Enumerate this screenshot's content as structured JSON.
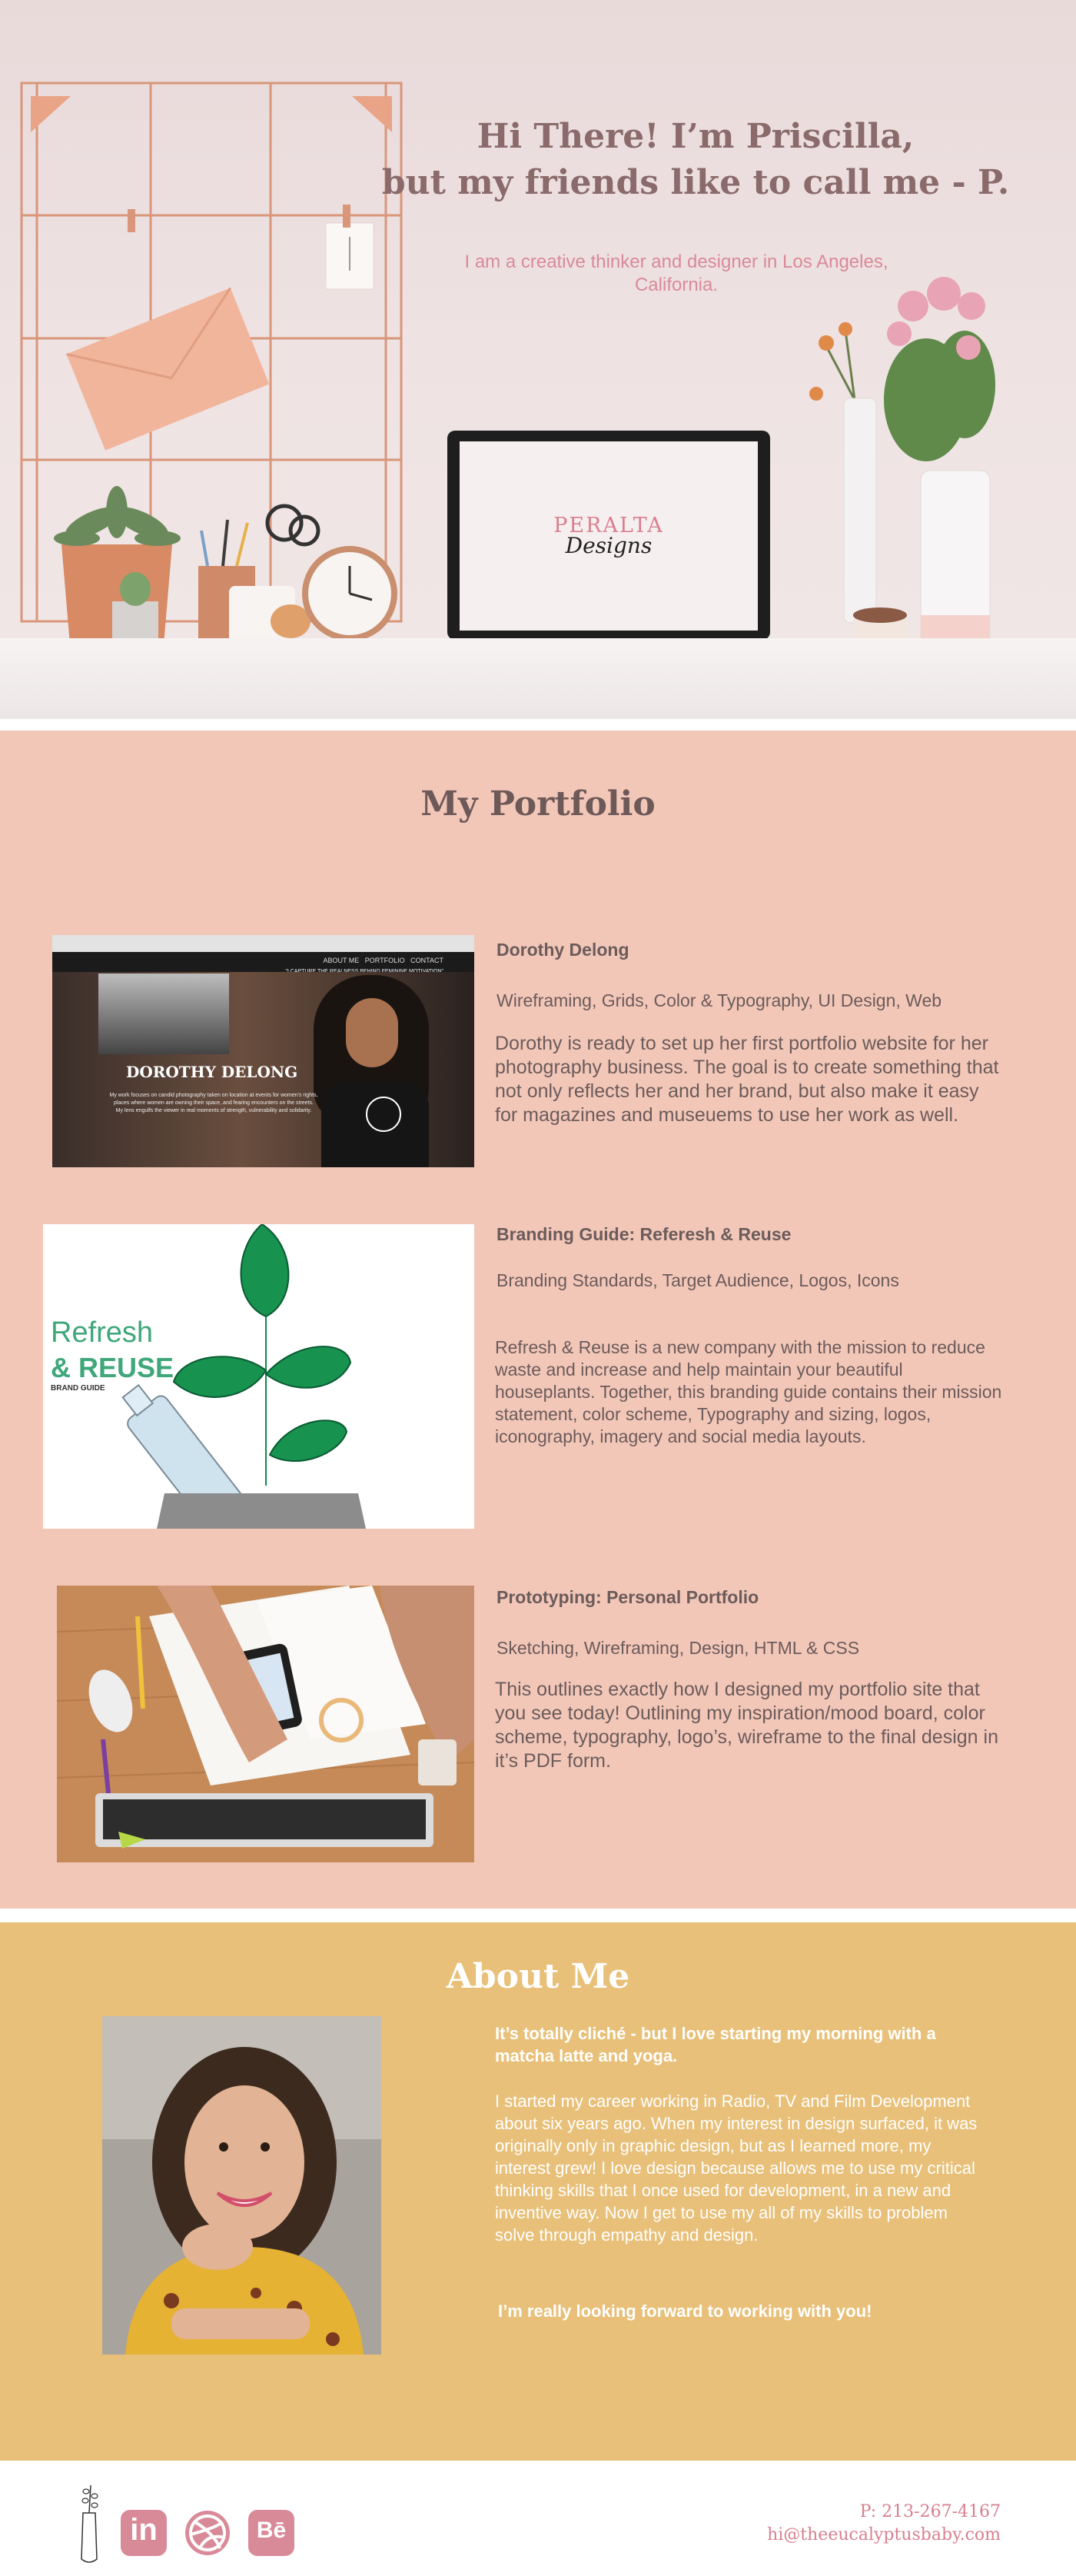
{
  "hero": {
    "title_line1": "Hi There! I’m Priscilla,",
    "title_line2": "but my friends like to call me - P.",
    "subtitle": "I am a creative thinker and designer in Los Angeles, California.",
    "laptop_logo_top": "PERALTA",
    "laptop_logo_script": "Designs"
  },
  "portfolio": {
    "heading": "My Portfolio",
    "projects": [
      {
        "title": "Dorothy Delong",
        "tags": "Wireframing, Grids, Color & Typography, UI Design, Web",
        "description": "Dorothy is ready to set up her first portfolio website for her photography business. The goal is to create something that not only reflects her and her brand, but also make it easy for magazines and museuems to use her work as well.",
        "image": {
          "nav": [
            "ABOUT ME",
            "PORTFOLIO",
            "CONTACT"
          ],
          "tagline": "\"I CAPTURE THE REALNESS BEHIND FEMININE MOTIVATION\"",
          "name": "DOROTHY DELONG",
          "blurb_line1": "My work focuses on candid photography taken on location at events for women's rights,",
          "blurb_line2": "places where women are owning their space, and fearing encounters on the streets.",
          "blurb_line3": "My lens engulfs the viewer in real moments of strength, vulnerability and solidarity."
        }
      },
      {
        "title": "Branding Guide: Referesh & Reuse",
        "tags": "Branding Standards, Target Audience, Logos, Icons",
        "description": "Refresh & Reuse is a new company with the mission to reduce waste and increase and help maintain your beautiful houseplants. Together, this branding guide contains their mission statement, color scheme, Typography and sizing, logos, iconography, imagery and social media layouts.",
        "image": {
          "word1": "Refresh",
          "word2": "& REUSE",
          "caption": "BRAND GUIDE"
        }
      },
      {
        "title": "Prototyping: Personal Portfolio",
        "tags": "Sketching, Wireframing, Design, HTML & CSS",
        "description": "This outlines exactly how I designed my portfolio site that you see today! Outlining my inspiration/mood board, color scheme, typography, logo’s, wireframe to the final design in it’s PDF form."
      }
    ]
  },
  "about": {
    "heading": "About Me",
    "lead": "It’s totally cliché - but I love starting my morning with a matcha latte and yoga.",
    "body": "I started my career working in Radio, TV and Film Development about six years ago. When my interest in design surfaced, it was originally only in graphic design, but as I learned more, my interest grew! I love design because allows me to use my critical thinking skills that I once used for development, in a new and inventive way. Now I get to use my all of my skills to problem solve through empathy and design.",
    "closing": "I’m really looking forward to working with you!"
  },
  "footer": {
    "phone": "P: 213-267-4167",
    "email": "hi@theeucalyptusbaby.com",
    "social": [
      {
        "icon": "linkedin-icon",
        "label": "in"
      },
      {
        "icon": "dribbble-icon"
      },
      {
        "icon": "behance-icon",
        "label": "Bē"
      }
    ]
  },
  "colors": {
    "portfolio_bg": "#f2c7b8",
    "about_bg": "#e8c079",
    "accent_pink": "#d97f8e",
    "text_brown": "#6b5b5b",
    "icon_pink": "#d98a98"
  }
}
